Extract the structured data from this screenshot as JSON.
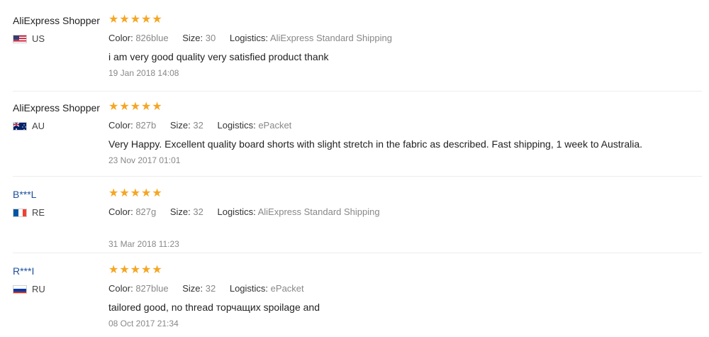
{
  "labels": {
    "color": "Color:",
    "size": "Size:",
    "logistics": "Logistics:"
  },
  "reviews": [
    {
      "name": "AliExpress Shopper",
      "name_style": "black",
      "country_code": "US",
      "flag": "us-flag-icon",
      "stars": 5,
      "color_value": "826blue",
      "size_value": "30",
      "logistics_value": "AliExpress Standard Shipping",
      "text": "i am very good quality very satisfied product thank",
      "date": "19 Jan 2018 14:08"
    },
    {
      "name": "AliExpress Shopper",
      "name_style": "black",
      "country_code": "AU",
      "flag": "au-flag-icon",
      "stars": 5,
      "color_value": "827b",
      "size_value": "32",
      "logistics_value": "ePacket",
      "text": "Very Happy. Excellent quality board shorts with slight stretch in the fabric as described. Fast shipping, 1 week to Australia.",
      "date": "23 Nov 2017 01:01"
    },
    {
      "name": "B***L",
      "name_style": "link",
      "country_code": "RE",
      "flag": "fr-flag-icon",
      "stars": 5,
      "color_value": "827g",
      "size_value": "32",
      "logistics_value": "AliExpress Standard Shipping",
      "text": "",
      "date": "31 Mar 2018 11:23"
    },
    {
      "name": "R***I",
      "name_style": "link",
      "country_code": "RU",
      "flag": "ru-flag-icon",
      "stars": 5,
      "color_value": "827blue",
      "size_value": "32",
      "logistics_value": "ePacket",
      "text": "tailored good, no thread торчащих spoilage and",
      "date": "08 Oct 2017 21:34"
    }
  ],
  "colors": {
    "star": "#f5a623",
    "link_name": "#1d4f9c",
    "divider": "#ececec"
  }
}
